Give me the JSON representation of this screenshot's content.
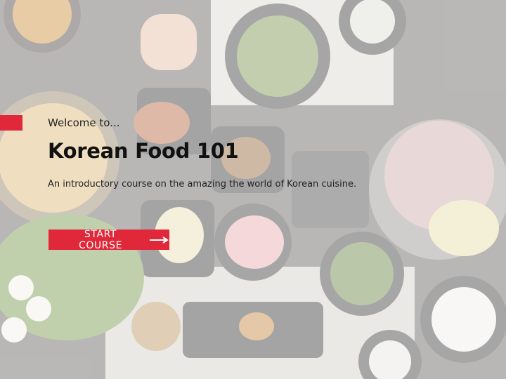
{
  "welcome_text": "Welcome to...",
  "title": "Korean Food 101",
  "subtitle": "An introductory course on the amazing the world of Korean cuisine.",
  "start_button": {
    "label": "START COURSE",
    "icon": "arrow-right-icon"
  },
  "colors": {
    "accent": "#e0283a"
  }
}
